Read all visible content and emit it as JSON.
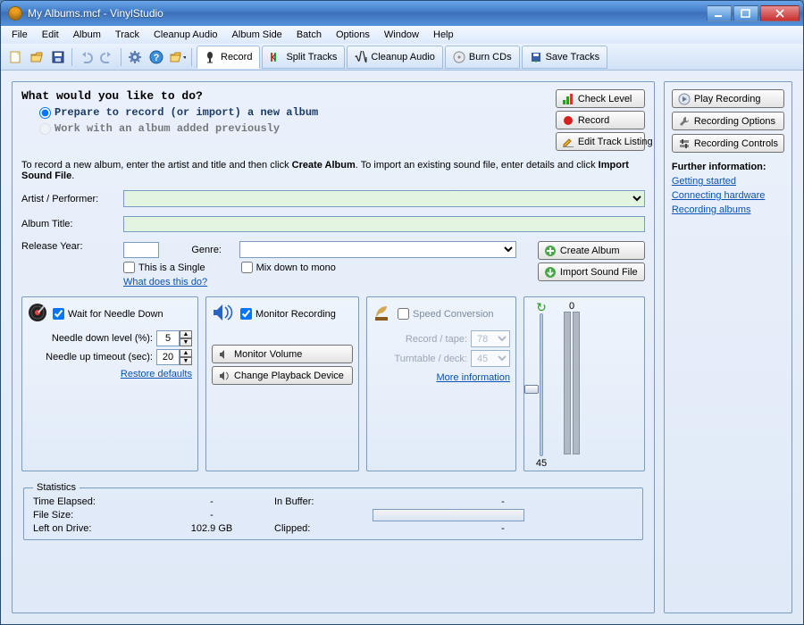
{
  "window": {
    "title": "My Albums.mcf - VinylStudio"
  },
  "menu": [
    "File",
    "Edit",
    "Album",
    "Track",
    "Cleanup Audio",
    "Album Side",
    "Batch",
    "Options",
    "Window",
    "Help"
  ],
  "tabs": [
    {
      "label": "Record",
      "active": true
    },
    {
      "label": "Split Tracks",
      "active": false
    },
    {
      "label": "Cleanup Audio",
      "active": false
    },
    {
      "label": "Burn CDs",
      "active": false
    },
    {
      "label": "Save Tracks",
      "active": false
    }
  ],
  "main": {
    "heading": "What would you like to do?",
    "radio1": "Prepare to record (or import) a new album",
    "radio2": "Work with an album added previously",
    "instr_a": "To record a new album, enter the artist and title and then click ",
    "instr_b": "Create Album",
    "instr_c": ".  To import an existing sound file, enter details and click ",
    "instr_d": "Import Sound File",
    "instr_e": ".",
    "artist_label": "Artist / Performer:",
    "album_label": "Album Title:",
    "year_label": "Release Year:",
    "genre_label": "Genre:",
    "single_label": "This is a Single",
    "mono_label": "Mix down to mono",
    "whatdoes": "What does this do?",
    "check_level": "Check Level",
    "record": "Record",
    "edit_listing": "Edit Track Listing",
    "create_album": "Create Album",
    "import_sound": "Import Sound File"
  },
  "needle": {
    "wait": "Wait for Needle Down",
    "down_label": "Needle down level (%):",
    "down_val": "5",
    "up_label": "Needle up timeout (sec):",
    "up_val": "20",
    "restore": "Restore defaults"
  },
  "monitor": {
    "label": "Monitor Recording",
    "vol": "Monitor Volume",
    "device": "Change Playback Device"
  },
  "speed": {
    "label": "Speed Conversion",
    "tape_label": "Record / tape:",
    "tape_val": "78",
    "deck_label": "Turntable / deck:",
    "deck_val": "45",
    "more": "More information"
  },
  "stats": {
    "legend": "Statistics",
    "time": "Time Elapsed:",
    "time_v": "-",
    "buffer": "In Buffer:",
    "buffer_v": "-",
    "size": "File Size:",
    "size_v": "-",
    "left": "Left on Drive:",
    "left_v": "102.9 GB",
    "clipped": "Clipped:",
    "clipped_v": "-"
  },
  "side": {
    "play": "Play Recording",
    "opts": "Recording Options",
    "ctrls": "Recording Controls",
    "further": "Further information:",
    "l1": "Getting started",
    "l2": "Connecting hardware",
    "l3": "Recording albums"
  },
  "slider": {
    "top": "0",
    "bottom": "45"
  }
}
